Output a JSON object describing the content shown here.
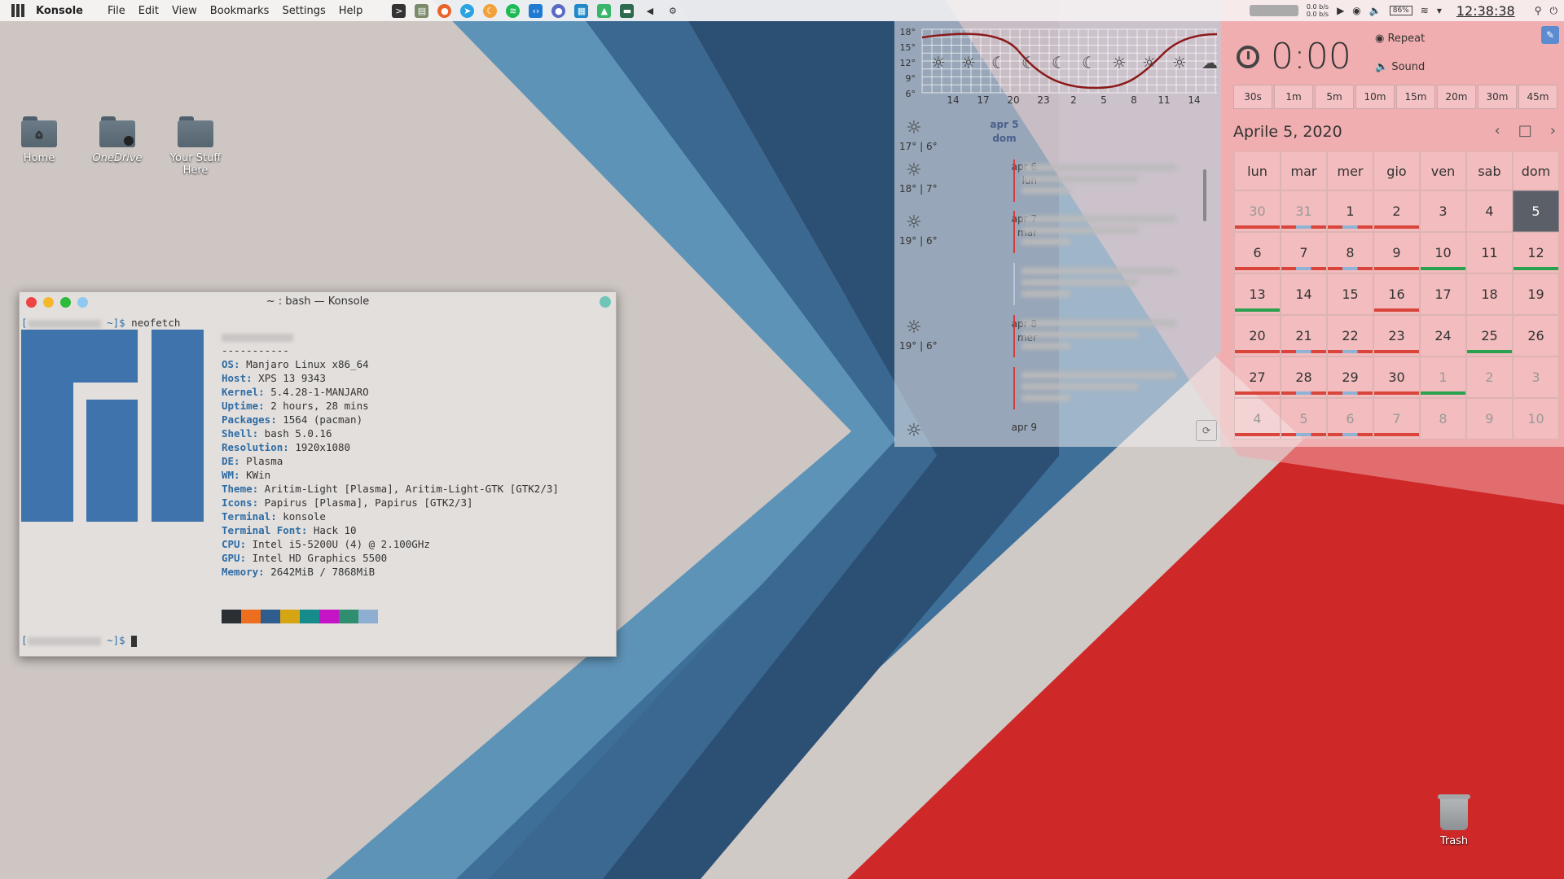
{
  "topbar": {
    "app_name": "Konsole",
    "menus": [
      "File",
      "Edit",
      "View",
      "Bookmarks",
      "Settings",
      "Help"
    ],
    "net_up": "0.0 b/s",
    "net_down": "0.0 b/s",
    "battery": "86%",
    "clock": "12:38:38"
  },
  "desktop": {
    "icons": [
      {
        "label": "Home"
      },
      {
        "label": "OneDrive"
      },
      {
        "label": "Your Stuff Here"
      }
    ],
    "trash_label": "Trash"
  },
  "konsole": {
    "title": "~ : bash — Konsole",
    "command": "neofetch",
    "prompt_suffix": "~]$",
    "separator": "-----------",
    "info": [
      {
        "k": "OS",
        "v": "Manjaro Linux x86_64"
      },
      {
        "k": "Host",
        "v": "XPS 13 9343"
      },
      {
        "k": "Kernel",
        "v": "5.4.28-1-MANJARO"
      },
      {
        "k": "Uptime",
        "v": "2 hours, 28 mins"
      },
      {
        "k": "Packages",
        "v": "1564 (pacman)"
      },
      {
        "k": "Shell",
        "v": "bash 5.0.16"
      },
      {
        "k": "Resolution",
        "v": "1920x1080"
      },
      {
        "k": "DE",
        "v": "Plasma"
      },
      {
        "k": "WM",
        "v": "KWin"
      },
      {
        "k": "Theme",
        "v": "Aritim-Light [Plasma], Aritim-Light-GTK [GTK2/3]"
      },
      {
        "k": "Icons",
        "v": "Papirus [Plasma], Papirus [GTK2/3]"
      },
      {
        "k": "Terminal",
        "v": "konsole"
      },
      {
        "k": "Terminal Font",
        "v": "Hack 10"
      },
      {
        "k": "CPU",
        "v": "Intel i5-5200U (4) @ 2.100GHz"
      },
      {
        "k": "GPU",
        "v": "Intel HD Graphics 5500"
      },
      {
        "k": "Memory",
        "v": "2642MiB / 7868MiB"
      }
    ],
    "swatch_colors": [
      "#2b2f33",
      "#ed6e1e",
      "#2e5d8e",
      "#d5a514",
      "#168b8b",
      "#c514c5",
      "#2f8e6f",
      "#8fafd2"
    ]
  },
  "weather": {
    "y_ticks": [
      "18°",
      "15°",
      "12°",
      "9°",
      "6°"
    ],
    "x_ticks": [
      "14",
      "17",
      "20",
      "23",
      "2",
      "5",
      "8",
      "11",
      "14"
    ],
    "days": [
      {
        "temps": "17° | 6°",
        "date": "apr 5",
        "dow": "dom"
      },
      {
        "temps": "18° | 7°",
        "date": "apr 6",
        "dow": "lun"
      },
      {
        "temps": "19° | 6°",
        "date": "apr 7",
        "dow": "mar"
      },
      {
        "temps": "19° | 6°",
        "date": "apr 8",
        "dow": "mer"
      },
      {
        "temps": "",
        "date": "apr 9",
        "dow": ""
      }
    ]
  },
  "timer": {
    "time": "0:00",
    "repeat_label": "Repeat",
    "sound_label": "Sound",
    "presets": [
      "30s",
      "1m",
      "5m",
      "10m",
      "15m",
      "20m",
      "30m",
      "45m"
    ]
  },
  "calendar": {
    "title": "Aprile 5, 2020",
    "weekdays": [
      "lun",
      "mar",
      "mer",
      "gio",
      "ven",
      "sab",
      "dom"
    ],
    "weeks": [
      [
        "30",
        "31",
        "1",
        "2",
        "3",
        "4",
        "5"
      ],
      [
        "6",
        "7",
        "8",
        "9",
        "10",
        "11",
        "12"
      ],
      [
        "13",
        "14",
        "15",
        "16",
        "17",
        "18",
        "19"
      ],
      [
        "20",
        "21",
        "22",
        "23",
        "24",
        "25",
        "26"
      ],
      [
        "27",
        "28",
        "29",
        "30",
        "1",
        "2",
        "3"
      ],
      [
        "4",
        "5",
        "6",
        "7",
        "8",
        "9",
        "10"
      ]
    ],
    "colors": {
      "red": "#d9453a",
      "blue": "#8fb3d6",
      "green": "#2aa14f",
      "today": "#5b5f68"
    }
  }
}
